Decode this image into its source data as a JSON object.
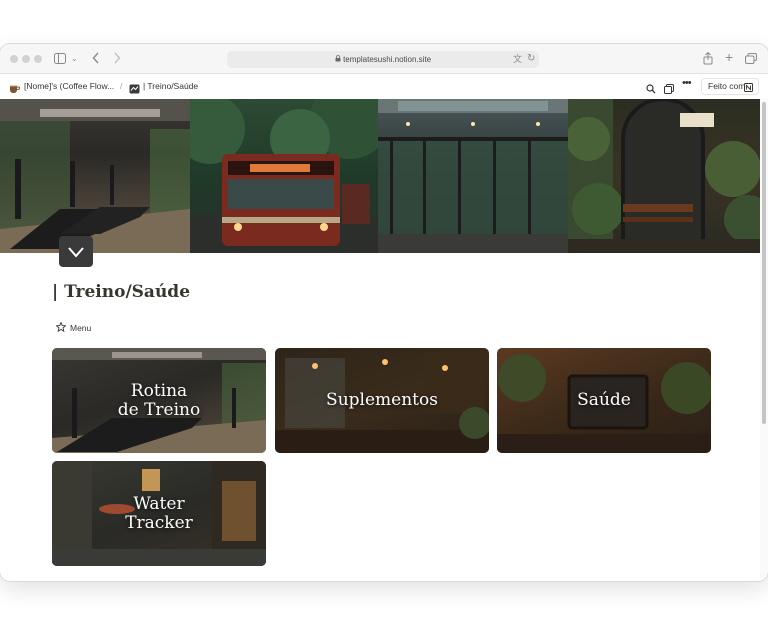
{
  "browser": {
    "url": "templatesushi.notion.site"
  },
  "notion": {
    "breadcrumb": [
      "[Nome]'s (Coffee Flow...",
      "/",
      "| Treino/Saúde"
    ],
    "publish_label": "Feito com"
  },
  "page": {
    "title": "| Treino/Saúde",
    "menu_label": "Menu"
  },
  "cards": [
    {
      "label": "Rotina\nde Treino"
    },
    {
      "label": "Suplementos"
    },
    {
      "label": "Saúde"
    },
    {
      "label": "Water\nTracker"
    }
  ],
  "icons": {
    "sidebar": "sidebar-icon",
    "back": "chevron-left-icon",
    "forward": "chevron-right-icon",
    "lock": "lock-icon",
    "translate": "translate-icon",
    "reload": "reload-icon",
    "share": "share-icon",
    "new_tab": "plus-icon",
    "tabs": "tabs-overview-icon",
    "search": "search-icon",
    "duplicate": "duplicate-icon",
    "more": "more-icon",
    "star": "star-icon",
    "notion": "notion-logo-icon"
  },
  "colors": {
    "toolbar_bg": "#f6f6f6",
    "text": "#37352f",
    "icon_bg": "#3a3a3a"
  }
}
